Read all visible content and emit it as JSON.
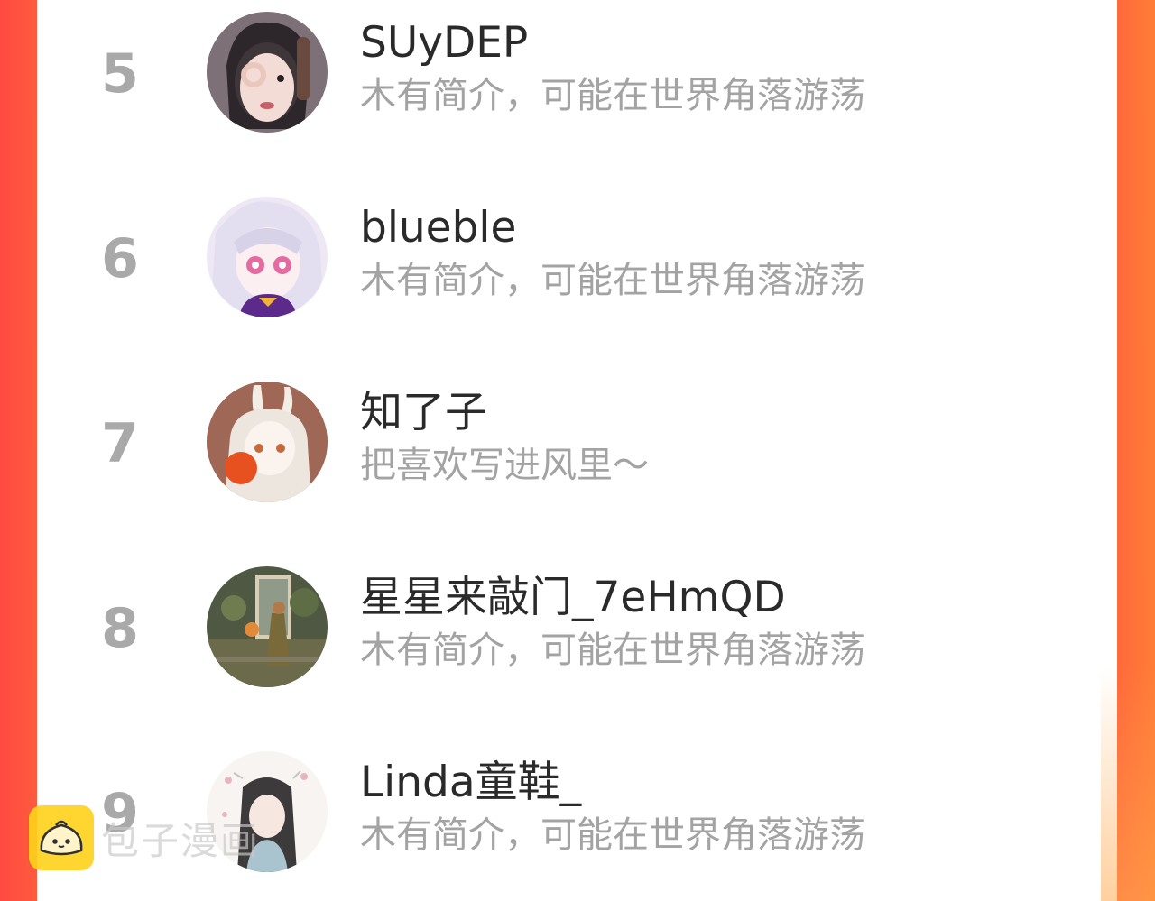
{
  "ranking_list": {
    "rows": [
      {
        "rank": "5",
        "name": "SUyDEP",
        "bio": "木有简介，可能在世界角落游荡"
      },
      {
        "rank": "6",
        "name": "blueble",
        "bio": "木有简介，可能在世界角落游荡"
      },
      {
        "rank": "7",
        "name": "知了子",
        "bio": "把喜欢写进风里～"
      },
      {
        "rank": "8",
        "name": "星星来敲门_7eHmQD",
        "bio": "木有简介，可能在世界角落游荡"
      },
      {
        "rank": "9",
        "name": "Linda童鞋_",
        "bio": "木有简介，可能在世界角落游荡"
      }
    ]
  },
  "watermark": {
    "text": "包子漫画"
  },
  "colors": {
    "side_gradient_left": "#ff4a42",
    "side_gradient_right": "#ff7d37",
    "rank_gray": "#a9a9a9",
    "name_text": "#2a2a2a",
    "bio_text": "#a3a3a3",
    "logo_yellow": "#ffd21a"
  }
}
